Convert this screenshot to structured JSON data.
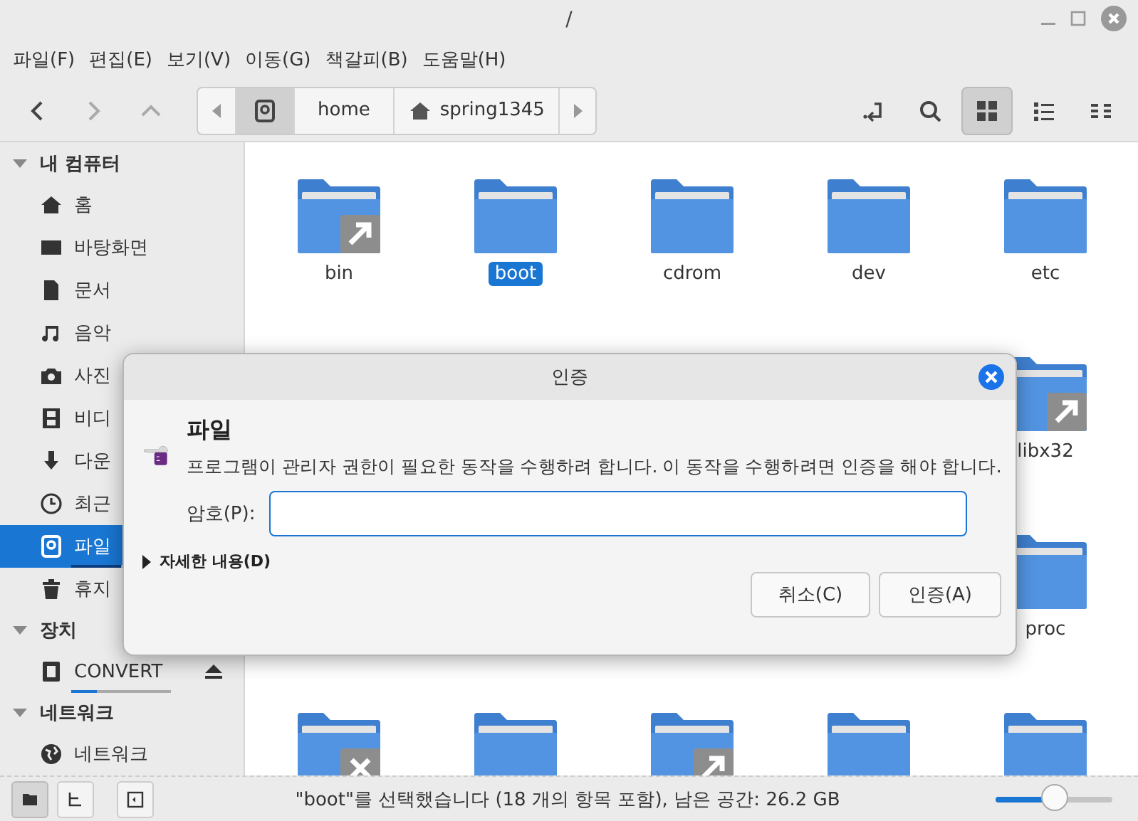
{
  "window": {
    "title": "/"
  },
  "menu": [
    "파일(F)",
    "편집(E)",
    "보기(V)",
    "이동(G)",
    "책갈피(B)",
    "도움말(H)"
  ],
  "breadcrumb": [
    {
      "selected": true
    },
    {
      "label": "home",
      "selected": false
    },
    {
      "label": "spring1345",
      "selected": false
    }
  ],
  "view_modes": [
    {
      "selected": true
    },
    {
      "selected": false
    },
    {
      "selected": false
    }
  ],
  "sidebar": [
    {
      "title": "내 컴퓨터",
      "expanded": true,
      "items": [
        {
          "label": "홈",
          "selected": false
        },
        {
          "label": "바탕화면",
          "selected": false
        },
        {
          "label": "문서",
          "selected": false
        },
        {
          "label": "음악",
          "selected": false
        },
        {
          "label": "사진",
          "selected": false
        },
        {
          "label": "비디",
          "selected": false
        },
        {
          "label": "다운",
          "selected": false
        },
        {
          "label": "최근",
          "selected": false
        },
        {
          "label": "파일",
          "selected": true,
          "level": 0.5
        },
        {
          "label": "휴지",
          "selected": false
        }
      ]
    },
    {
      "title": "장치",
      "expanded": true,
      "items": [
        {
          "label": "CONVERT",
          "selected": false,
          "level": 0.25,
          "eject": true
        }
      ]
    },
    {
      "title": "네트워크",
      "expanded": true,
      "items": [
        {
          "label": "네트워크",
          "selected": false
        }
      ]
    }
  ],
  "files": [
    [
      {
        "name": "bin",
        "selected": false,
        "symlink": true
      },
      {
        "name": "boot",
        "selected": true
      },
      {
        "name": "cdrom",
        "selected": false
      },
      {
        "name": "dev",
        "selected": false
      },
      {
        "name": "etc",
        "selected": false
      }
    ],
    [
      {
        "name": "libx32",
        "selected": false,
        "symlink": true
      }
    ],
    [
      {
        "name": "proc",
        "selected": false
      }
    ],
    [
      {
        "selected": false,
        "broken_link": true
      },
      {
        "selected": false
      },
      {
        "selected": false,
        "symlink": true
      },
      {
        "selected": false
      },
      {
        "selected": false
      }
    ]
  ],
  "status_bar": {
    "text": "\"boot\"를 선택했습니다 (18 개의 항목 포함), 남은 공간: 26.2 GB",
    "zoom": {
      "level": 0.5
    }
  },
  "dialog": {
    "title": "인증",
    "heading": "파일",
    "message": "프로그램이 관리자 권한이 필요한 동작을 수행하려 합니다. 이 동작을 수행하려면 인증을 해야 합니다.",
    "password_label": "암호(P):",
    "details": {
      "label": "자세한 내용(D)",
      "expanded": false
    },
    "buttons": [
      "취소(C)",
      "인증(A)"
    ]
  }
}
